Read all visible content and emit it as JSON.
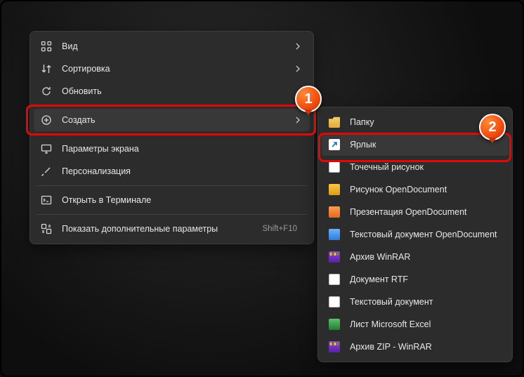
{
  "main_menu": {
    "view": "Вид",
    "sort": "Сортировка",
    "refresh": "Обновить",
    "create": "Создать",
    "display": "Параметры экрана",
    "personalize": "Персонализация",
    "terminal": "Открыть в Терминале",
    "more": "Показать дополнительные параметры",
    "more_shortcut": "Shift+F10"
  },
  "sub_menu": {
    "folder": "Папку",
    "shortcut": "Ярлык",
    "bmp": "Точечный рисунок",
    "odg": "Рисунок OpenDocument",
    "odp": "Презентация OpenDocument",
    "odt": "Текстовый документ OpenDocument",
    "rar": "Архив WinRAR",
    "rtf": "Документ RTF",
    "txt": "Текстовый документ",
    "xls": "Лист Microsoft Excel",
    "zip": "Архив ZIP - WinRAR"
  },
  "annotations": {
    "step1": "1",
    "step2": "2"
  }
}
